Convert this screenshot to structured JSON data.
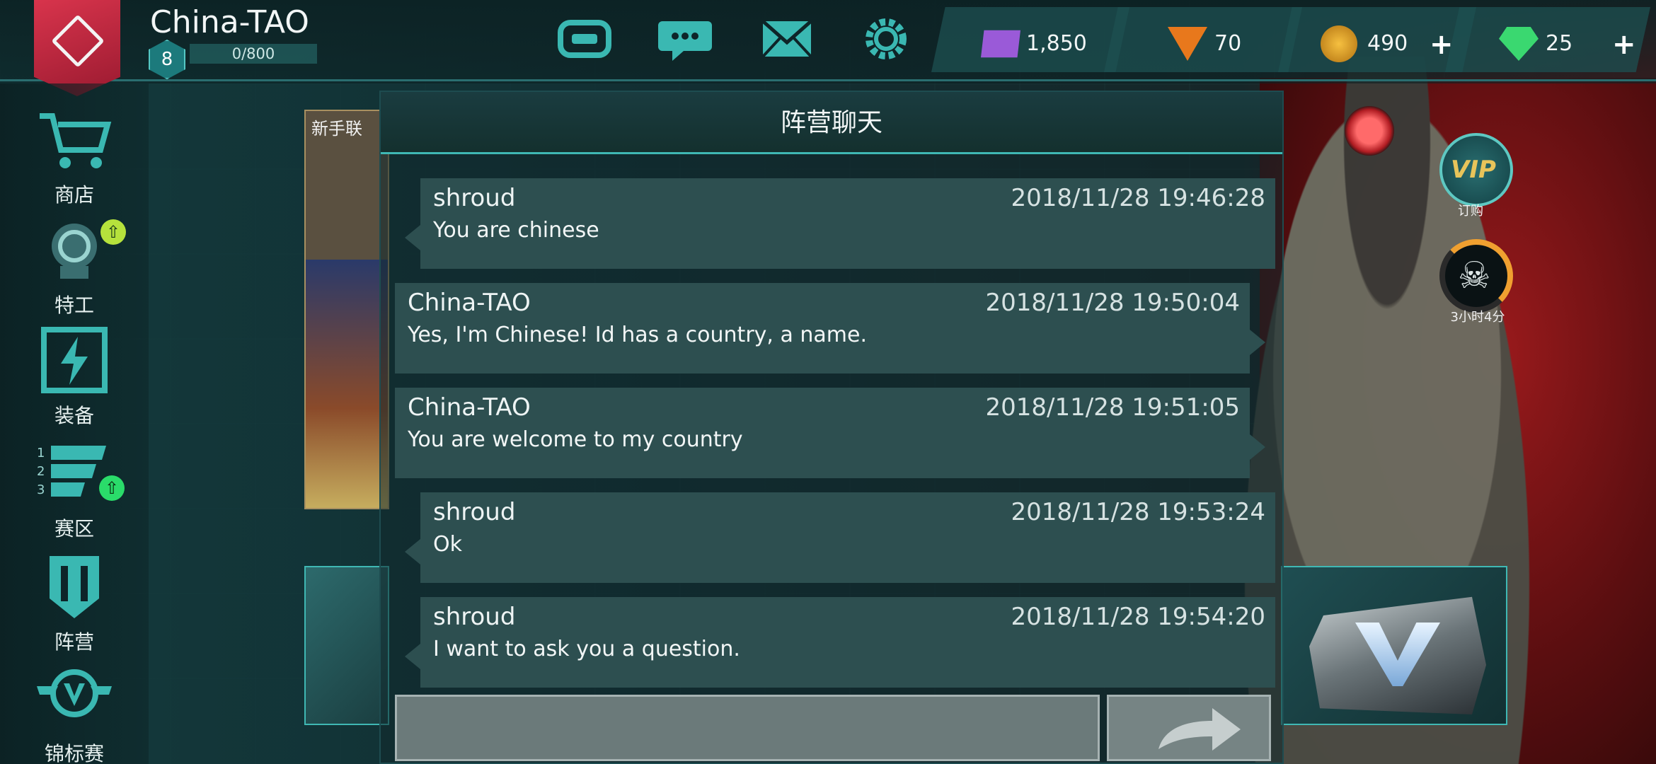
{
  "player": {
    "name": "China-TAO",
    "level": "8",
    "xp": "0/800"
  },
  "resources": [
    {
      "name": "credits",
      "value": "1,850",
      "color": "#9a5ad8"
    },
    {
      "name": "warbonds",
      "value": "70",
      "color": "#e8781c"
    },
    {
      "name": "gold",
      "value": "490",
      "color": "#e8a418",
      "plus": "+"
    },
    {
      "name": "diamonds",
      "value": "25",
      "color": "#3ad870",
      "plus": "+"
    }
  ],
  "sidebar": {
    "items": [
      {
        "label": "商店",
        "icon": "cart-icon"
      },
      {
        "label": "特工",
        "icon": "agent-icon"
      },
      {
        "label": "装备",
        "icon": "equipment-icon"
      },
      {
        "label": "赛区",
        "icon": "league-icon"
      },
      {
        "label": "阵营",
        "icon": "faction-icon"
      },
      {
        "label": "锦标赛",
        "icon": "tournament-icon"
      }
    ]
  },
  "background": {
    "panel_label": "新手联"
  },
  "widgets": {
    "vip_text": "VIP",
    "vip_label": "订购",
    "timer_label": "3小时4分"
  },
  "chat": {
    "title": "阵营聊天",
    "messages": [
      {
        "sender": "shroud",
        "time": "2018/11/28 19:46:28",
        "text": "You are chinese"
      },
      {
        "sender": "China-TAO",
        "time": "2018/11/28 19:50:04",
        "text": "Yes, I'm Chinese! Id has a country, a name."
      },
      {
        "sender": "China-TAO",
        "time": "2018/11/28 19:51:05",
        "text": "You are welcome to my country"
      },
      {
        "sender": "shroud",
        "time": "2018/11/28 19:53:24",
        "text": "Ok"
      },
      {
        "sender": "shroud",
        "time": "2018/11/28 19:54:20",
        "text": "I want to ask you a question."
      }
    ],
    "input_placeholder": ""
  }
}
